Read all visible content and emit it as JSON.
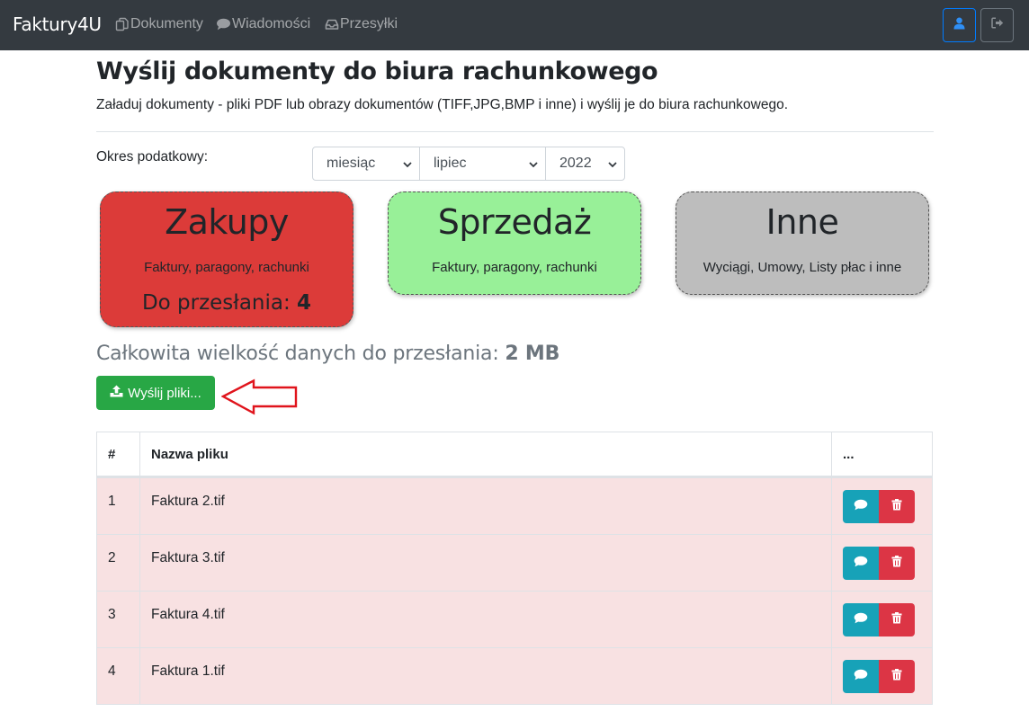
{
  "navbar": {
    "brand": "Faktury4U",
    "links": [
      {
        "label": "Dokumenty",
        "icon": "documents-icon"
      },
      {
        "label": "Wiadomości",
        "icon": "chat-icon"
      },
      {
        "label": "Przesyłki",
        "icon": "inbox-icon"
      }
    ],
    "colors": {
      "background": "#343a40",
      "user_button": "#007bff"
    }
  },
  "page": {
    "title": "Wyślij dokumenty do biura rachunkowego",
    "lead": "Załaduj dokumenty - pliki PDF lub obrazy dokumentów (TIFF,JPG,BMP i inne) i wyślij je do biura rachunkowego."
  },
  "period": {
    "label": "Okres podatkowy:",
    "type": "miesiąc",
    "month": "lipiec",
    "year": "2022"
  },
  "categories": [
    {
      "title": "Zakupy",
      "subtitle": "Faktury, paragony, rachunki",
      "count_label": "Do przesłania:",
      "count": "4",
      "color": "#dc3b39"
    },
    {
      "title": "Sprzedaż",
      "subtitle": "Faktury, paragony, rachunki",
      "color": "#98f098"
    },
    {
      "title": "Inne",
      "subtitle": "Wyciągi, Umowy, Listy płac i inne",
      "color": "#bdbdbd"
    }
  ],
  "total": {
    "label": "Całkowita wielkość danych do przesłania:",
    "value": "2 MB"
  },
  "send_button": {
    "label": "Wyślij pliki...",
    "icon": "upload-icon",
    "color": "#28a745"
  },
  "table": {
    "headers": [
      "#",
      "Nazwa pliku",
      "..."
    ],
    "rows": [
      {
        "num": "1",
        "name": "Faktura 2.tif"
      },
      {
        "num": "2",
        "name": "Faktura 3.tif"
      },
      {
        "num": "3",
        "name": "Faktura 4.tif"
      },
      {
        "num": "4",
        "name": "Faktura 1.tif"
      }
    ],
    "row_color": "#f8e1e2",
    "actions": {
      "comment_icon": "comment-icon",
      "delete_icon": "trash-icon",
      "comment_color": "#17a2b8",
      "delete_color": "#dc3545"
    }
  },
  "annotation": {
    "arrow_color": "#e0141c"
  }
}
